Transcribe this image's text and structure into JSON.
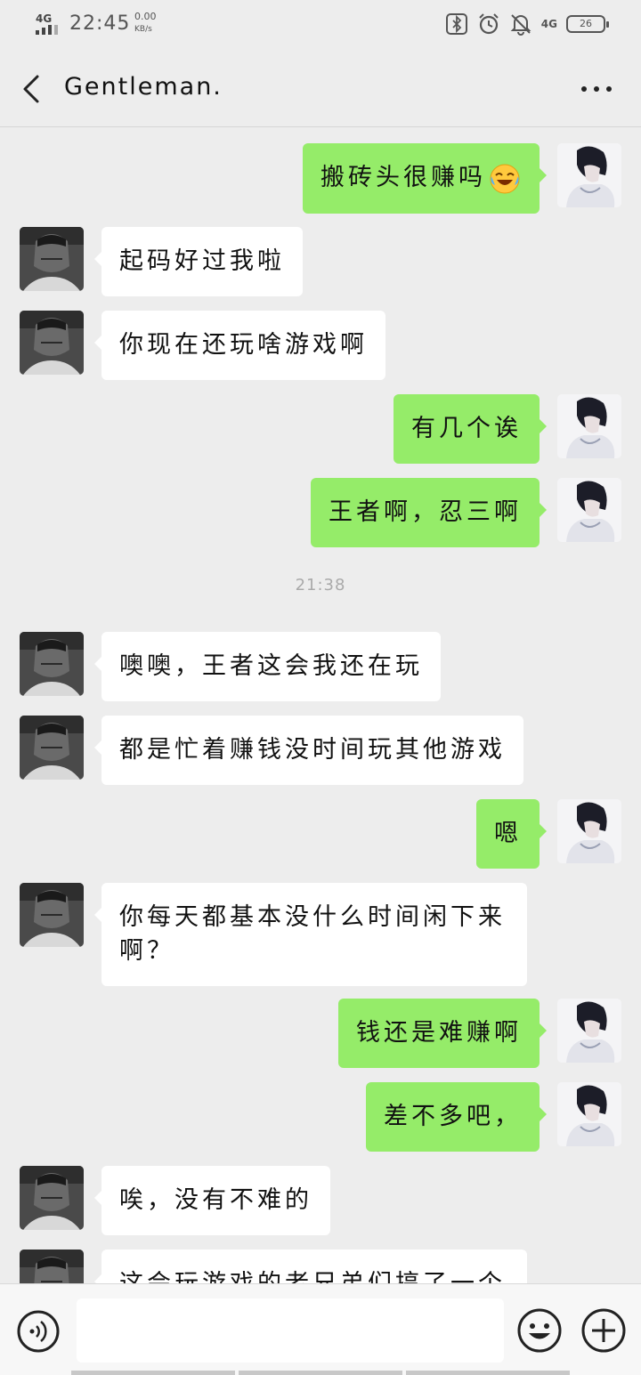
{
  "status_bar": {
    "network": "4G",
    "time": "22:45",
    "speed_value": "0.00",
    "speed_unit": "KB/s",
    "network_right": "4G",
    "battery": "26",
    "icons": [
      "bluetooth-icon",
      "alarm-icon",
      "mute-bell-icon",
      "signal-icon",
      "battery-icon"
    ]
  },
  "header": {
    "title": "Gentleman.",
    "back_icon": "chevron-left-icon",
    "more_icon": "more-dots-icon"
  },
  "messages": [
    {
      "side": "right",
      "text": "搬砖头很赚吗",
      "emoji": "rolling-laughing-emoji"
    },
    {
      "side": "left",
      "text": "起码好过我啦"
    },
    {
      "side": "left",
      "text": "你现在还玩啥游戏啊"
    },
    {
      "side": "right",
      "text": "有几个诶"
    },
    {
      "side": "right",
      "text": "王者啊，忍三啊"
    },
    {
      "side": "time",
      "text": "21:38"
    },
    {
      "side": "left",
      "text": "噢噢，王者这会我还在玩"
    },
    {
      "side": "left",
      "text": "都是忙着赚钱没时间玩其他游戏"
    },
    {
      "side": "right",
      "text": "嗯"
    },
    {
      "side": "left",
      "text": "你每天都基本没什么时间闲下来啊？"
    },
    {
      "side": "right",
      "text": "钱还是难赚啊"
    },
    {
      "side": "right",
      "text": "差不多吧，"
    },
    {
      "side": "left",
      "text": "唉，没有不难的"
    },
    {
      "side": "left",
      "text": "这会玩游戏的老兄弟们搞了一个"
    }
  ],
  "input_bar": {
    "voice_icon": "voice-icon",
    "emoji_icon": "emoji-icon",
    "plus_icon": "plus-icon",
    "placeholder": ""
  },
  "colors": {
    "background": "#ededed",
    "sent_bubble": "#95ec69",
    "received_bubble": "#ffffff"
  }
}
